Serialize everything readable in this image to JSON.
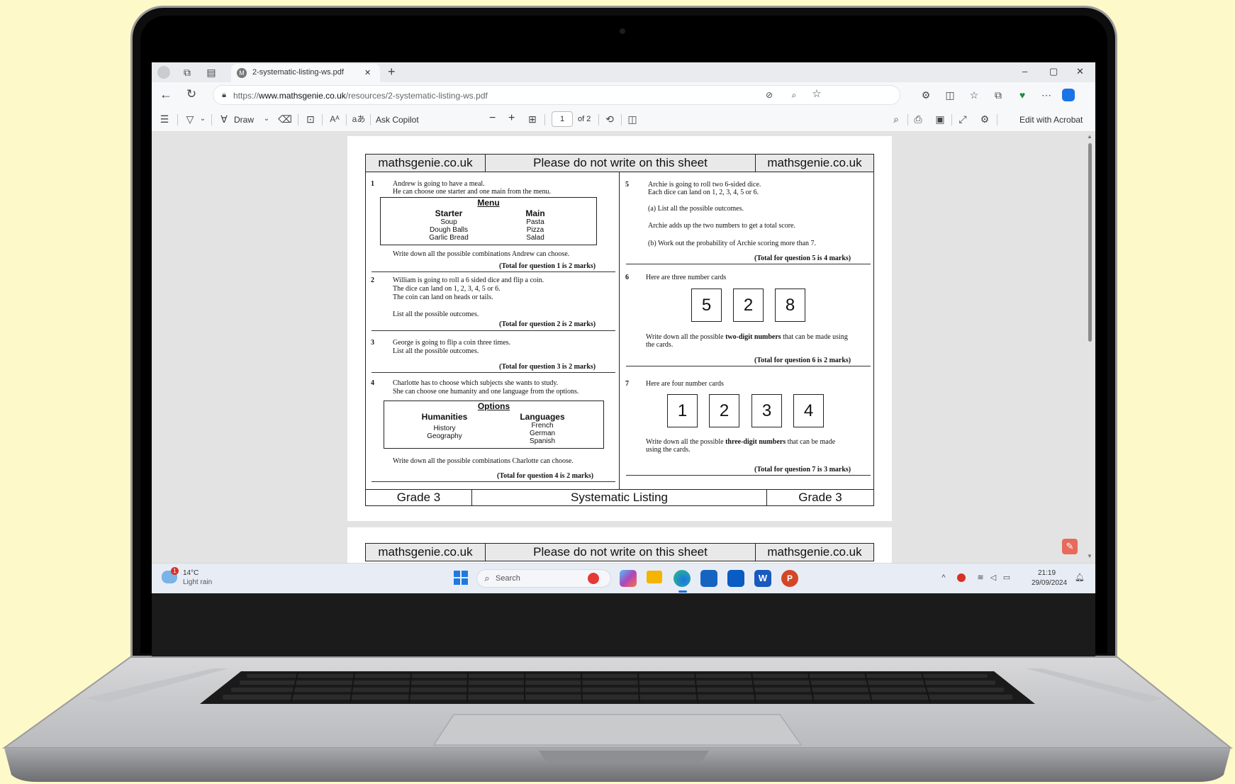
{
  "browser": {
    "tab_title": "2-systematic-listing-ws.pdf",
    "tab_close": "✕",
    "new_tab": "+",
    "url_prefix": "https://",
    "url_domain": "www.mathsgenie.co.uk",
    "url_path": "/resources/2-systematic-listing-ws.pdf",
    "window_controls": [
      "–",
      "▢",
      "✕"
    ]
  },
  "pdf_toolbar": {
    "draw_label": "Draw",
    "ask_copilot": "Ask Copilot",
    "page_number": "1",
    "page_total": "of 2",
    "edit_acrobat": "Edit with Acrobat",
    "zoom_out": "−",
    "zoom_in": "+"
  },
  "worksheet": {
    "header_left": "mathsgenie.co.uk",
    "header_center": "Please do not write on this sheet",
    "header_right": "mathsgenie.co.uk",
    "footer_left": "Grade 3",
    "footer_center": "Systematic Listing",
    "footer_right": "Grade 3",
    "q1": {
      "num": "1",
      "line1": "Andrew is going to have a meal.",
      "line2": "He can choose one starter and one main from the menu.",
      "menu_title": "Menu",
      "starter_head": "Starter",
      "main_head": "Main",
      "starters": [
        "Soup",
        "Dough Balls",
        "Garlic Bread"
      ],
      "mains": [
        "Pasta",
        "Pizza",
        "Salad"
      ],
      "instruction": "Write down all the possible combinations Andrew can choose.",
      "marks": "(Total for question 1 is 2 marks)"
    },
    "q2": {
      "num": "2",
      "line1": "William is going to roll a 6 sided dice and flip a coin.",
      "line2": "The dice can land on 1, 2, 3, 4, 5 or 6.",
      "line3": "The coin can land on heads or tails.",
      "instruction": "List all the possible outcomes.",
      "marks": "(Total for question 2 is 2 marks)"
    },
    "q3": {
      "num": "3",
      "line1": "George is going to flip a coin three times.",
      "line2": "List all the possible outcomes.",
      "marks": "(Total for question 3 is 2 marks)"
    },
    "q4": {
      "num": "4",
      "line1": "Charlotte has to choose which subjects she wants to study.",
      "line2": "She can choose one humanity and one language from the options.",
      "options_title": "Options",
      "hum_head": "Humanities",
      "lang_head": "Languages",
      "humanities": [
        "History",
        "Geography"
      ],
      "languages": [
        "French",
        "German",
        "Spanish"
      ],
      "instruction": "Write down all the possible combinations Charlotte can choose.",
      "marks": "(Total for question 4 is 2 marks)"
    },
    "q5": {
      "num": "5",
      "line1": "Archie is going to roll two 6-sided dice.",
      "line2": "Each dice can land on 1, 2, 3, 4, 5 or 6.",
      "part_a": "(a) List all the possible outcomes.",
      "middle": "Archie adds up the two numbers to get a total score.",
      "part_b": "(b) Work out the probability of Archie scoring more than 7.",
      "marks": "(Total for question 5 is 4 marks)"
    },
    "q6": {
      "num": "6",
      "intro": "Here are three number cards",
      "cards": [
        "5",
        "2",
        "8"
      ],
      "instr_pre": "Write down all the possible ",
      "instr_bold": "two-digit numbers",
      "instr_post": " that can be made using",
      "instr_line2": "the cards.",
      "marks": "(Total for question 6 is 2 marks)"
    },
    "q7": {
      "num": "7",
      "intro": "Here are four number cards",
      "cards": [
        "1",
        "2",
        "3",
        "4"
      ],
      "instr_pre": "Write down all the possible ",
      "instr_bold": "three-digit numbers",
      "instr_post": " that can be made",
      "instr_line2": "using the cards.",
      "marks": "(Total for question 7 is 3 marks)"
    }
  },
  "taskbar": {
    "weather_temp": "14°C",
    "weather_desc": "Light rain",
    "weather_badge": "1",
    "search_placeholder": "Search",
    "time": "21:19",
    "date": "29/09/2024"
  },
  "colors": {
    "background": "#fdf9c9",
    "edge_blue": "#1a73e8",
    "acrobat_red": "#e86a5c"
  }
}
